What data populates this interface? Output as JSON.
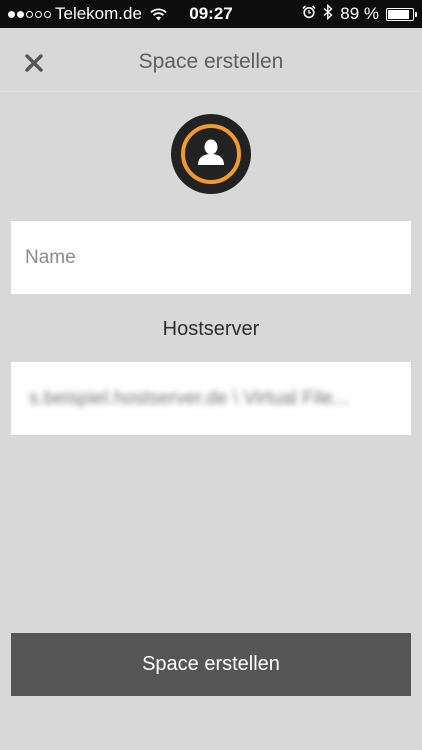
{
  "status_bar": {
    "signal_bars_filled": 2,
    "signal_bars_total": 5,
    "carrier": "Telekom.de",
    "time": "09:27",
    "battery_percent": "89 %",
    "battery_level": 0.89
  },
  "header": {
    "title": "Space erstellen",
    "close_icon": "close-icon"
  },
  "avatar": {
    "icon": "user-icon",
    "ring_color": "#f29b2d"
  },
  "form": {
    "name_placeholder": "Name",
    "name_value": "",
    "hostserver_label": "Hostserver",
    "hostserver_value": "s.beispiel.hostserver.de \\ Virtual File..."
  },
  "submit": {
    "label": "Space erstellen"
  },
  "colors": {
    "background": "#d8d8d8",
    "accent": "#f29b2d",
    "button": "#555555"
  }
}
